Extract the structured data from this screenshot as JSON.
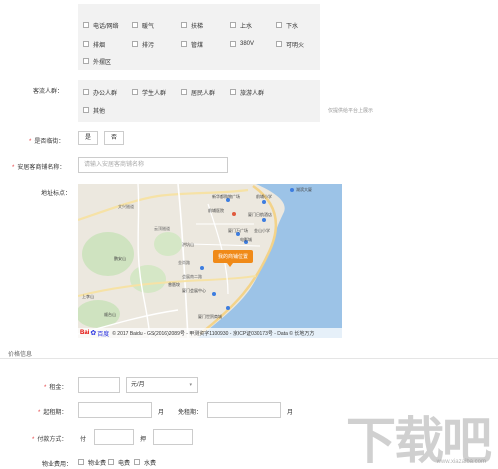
{
  "amenities": {
    "items": [
      {
        "label": "电话/网络"
      },
      {
        "label": "暖气"
      },
      {
        "label": "扶梯"
      },
      {
        "label": "上水"
      },
      {
        "label": "下水"
      },
      {
        "label": "排烟"
      },
      {
        "label": "排污"
      },
      {
        "label": "管煤"
      },
      {
        "label": "380V"
      },
      {
        "label": "可明火"
      },
      {
        "label": "外摆区"
      }
    ]
  },
  "customer_flow": {
    "label": "客流人群：",
    "items": [
      {
        "label": "办公人群"
      },
      {
        "label": "学生人群"
      },
      {
        "label": "居民人群"
      },
      {
        "label": "旅游人群"
      },
      {
        "label": "其他"
      }
    ],
    "hint": "仅提供给平台上展示"
  },
  "near_street": {
    "label": "是否临街：",
    "options": [
      "是",
      "否"
    ]
  },
  "shop_name": {
    "label": "安居客商铺名称：",
    "placeholder": "请输入安居客商铺名称"
  },
  "address": {
    "label": "地址标点："
  },
  "map": {
    "marker": "我的商铺位置",
    "copyright": "© 2017 Baidu - GS(2016)2089号 - 甲测资字1100930 - 京ICP证030173号 - Data © 长地万方",
    "logo_bai": "Bai",
    "logo_du": "百度",
    "places": [
      "新华都购物广场",
      "前埔小学",
      "前埔医院",
      "厦门日航酒店",
      "厦门万广场",
      "电影城",
      "金山小学",
      "湖滨大厦",
      "文兴隧道",
      "云顶隧道",
      "洪坑山",
      "鹏安山",
      "金尚路",
      "会展南二路",
      "曾厝垵",
      "厦门会展中心",
      "上李山",
      "顺台山",
      "厦门世贸商城"
    ]
  },
  "price_section": {
    "title": "价格信息"
  },
  "rent": {
    "label": "租金：",
    "value": "",
    "unit": "元/月"
  },
  "lease_period": {
    "label": "起租期：",
    "unit": "月",
    "free_label": "免租期：",
    "free_unit": "月"
  },
  "payment": {
    "label": "付款方式：",
    "pay_label": "付",
    "deposit_label": "押"
  },
  "property_fee": {
    "label": "物业费用：",
    "items": [
      {
        "label": "物业费"
      },
      {
        "label": "电费"
      },
      {
        "label": "水费"
      }
    ]
  },
  "watermark": {
    "big": "下载吧",
    "url": "www.xiazaiba.com"
  }
}
